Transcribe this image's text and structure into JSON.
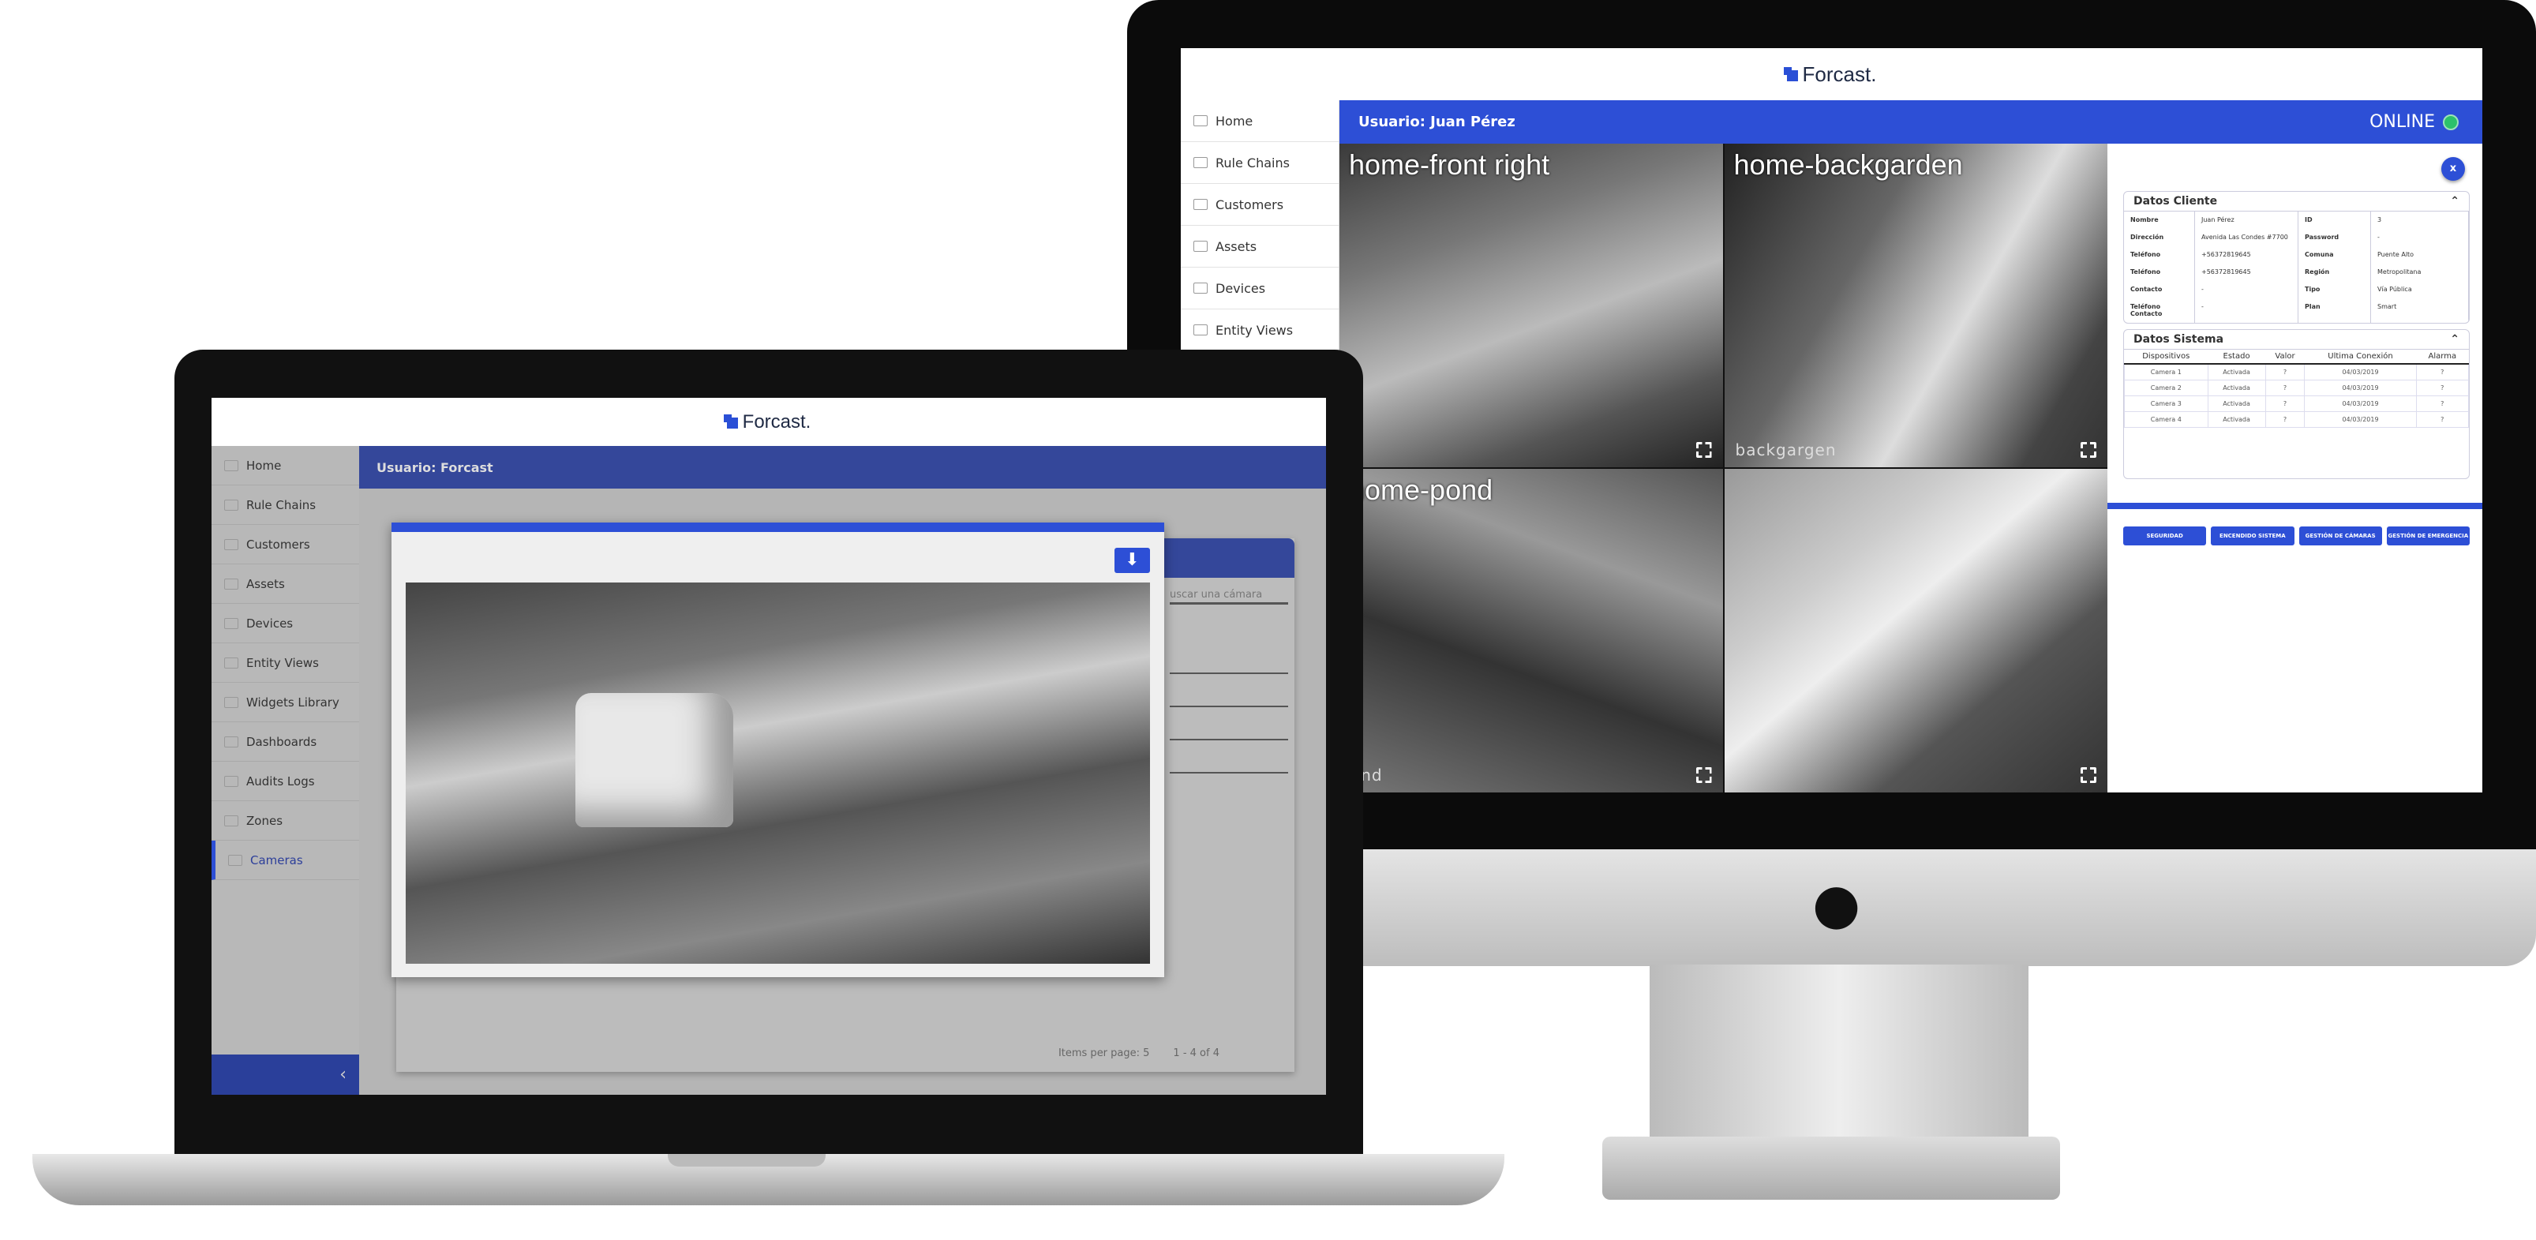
{
  "brand": {
    "name": "Forcast.",
    "accent": "#2d4fd6",
    "online_color": "#2cc16b"
  },
  "monitor": {
    "sidebar": [
      {
        "label": "Home",
        "icon": "home-icon"
      },
      {
        "label": "Rule Chains",
        "icon": "code-icon"
      },
      {
        "label": "Customers",
        "icon": "customers-icon"
      },
      {
        "label": "Assets",
        "icon": "assets-icon"
      },
      {
        "label": "Devices",
        "icon": "devices-icon"
      },
      {
        "label": "Entity Views",
        "icon": "entity-views-icon"
      }
    ],
    "user": "Usuario: Juan Pérez",
    "status": "ONLINE",
    "cameras": [
      {
        "title": "home-front right",
        "footer": ""
      },
      {
        "title": "home-backgarden",
        "footer": "backgargen"
      },
      {
        "title": "home-pond",
        "footer": "ond"
      },
      {
        "title": "",
        "footer": ""
      }
    ],
    "close_label": "x",
    "cliente": {
      "title": "Datos Cliente",
      "rows": [
        {
          "k1": "Nombre",
          "v1": "Juan Pérez",
          "k2": "ID",
          "v2": "3"
        },
        {
          "k1": "Dirección",
          "v1": "Avenida Las Condes #7700",
          "k2": "Password",
          "v2": "-"
        },
        {
          "k1": "Teléfono",
          "v1": "+56372819645",
          "k2": "Comuna",
          "v2": "Puente Alto"
        },
        {
          "k1": "Teléfono",
          "v1": "+56372819645",
          "k2": "Región",
          "v2": "Metropolitana"
        },
        {
          "k1": "Contacto",
          "v1": "-",
          "k2": "Tipo",
          "v2": "Vía Pública"
        },
        {
          "k1": "Teléfono Contacto",
          "v1": "-",
          "k2": "Plan",
          "v2": "Smart"
        }
      ]
    },
    "sistema": {
      "title": "Datos Sistema",
      "headers": [
        "Dispositivos",
        "Estado",
        "Valor",
        "Ultima Conexión",
        "Alarma"
      ],
      "rows": [
        [
          "Camera 1",
          "Activada",
          "?",
          "04/03/2019",
          "?"
        ],
        [
          "Camera 2",
          "Activada",
          "?",
          "04/03/2019",
          "?"
        ],
        [
          "Camera 3",
          "Activada",
          "?",
          "04/03/2019",
          "?"
        ],
        [
          "Camera 4",
          "Activada",
          "?",
          "04/03/2019",
          "?"
        ]
      ]
    },
    "actions": [
      "SEGURIDAD",
      "ENCENDIDO SISTEMA",
      "GESTIÓN DE CÁMARAS",
      "GESTIÓN DE EMERGENCIA"
    ]
  },
  "laptop": {
    "sidebar": [
      {
        "label": "Home"
      },
      {
        "label": "Rule Chains"
      },
      {
        "label": "Customers"
      },
      {
        "label": "Assets"
      },
      {
        "label": "Devices"
      },
      {
        "label": "Entity Views"
      },
      {
        "label": "Widgets Library"
      },
      {
        "label": "Dashboards"
      },
      {
        "label": "Audits Logs"
      },
      {
        "label": "Zones"
      },
      {
        "label": "Cameras",
        "active": true
      }
    ],
    "user": "Usuario: Forcast",
    "search_placeholder": "uscar una cámara",
    "items_per_page": "Items per page: 5",
    "range": "1 - 4 of 4",
    "collapse": "‹",
    "download": "⬇"
  }
}
